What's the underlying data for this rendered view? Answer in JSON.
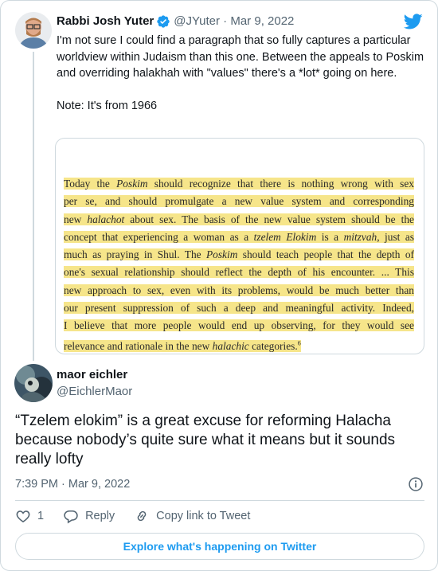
{
  "quoted_tweet": {
    "author_name": "Rabbi Josh Yuter",
    "handle_date": "@JYuter · Mar 9, 2022",
    "text": "I'm not sure I could find a paragraph that so fully captures a particular worldview within Judaism than this one. Between the appeals to Poskim and overriding halakhah with \"values\" there's a *lot* going on here.\n\nNote: It's from 1966",
    "image": {
      "lines": [
        [
          "Today the ",
          {
            "i": "Poskim"
          },
          " should recognize that there is nothing wrong with sex"
        ],
        [
          "per se, and should promulgate a new value system and corresponding"
        ],
        [
          "new ",
          {
            "i": "halachot"
          },
          " about sex. The basis of the new value system should be the"
        ],
        [
          "concept that experiencing a woman as a ",
          {
            "i": "tzelem Elokim"
          },
          " is a ",
          {
            "i": "mitzvah"
          },
          ", just as"
        ],
        [
          "much as praying in Shul. The ",
          {
            "i": "Poskim"
          },
          " should teach people that the depth of"
        ],
        [
          "one's sexual relationship should reflect the depth of his encounter. ... This"
        ],
        [
          "new approach to sex, even with its problems, would be much better than"
        ],
        [
          "our present suppression of such a deep and meaningful activity. Indeed,"
        ],
        [
          "I believe that more people would end up observing, for they would see"
        ],
        [
          "relevance and rationale in the new ",
          {
            "i": "halachic"
          },
          " categories.",
          {
            "sup": "6"
          }
        ]
      ]
    }
  },
  "tweet": {
    "author_name": "maor eichler",
    "handle": "@EichlerMaor",
    "text": "“Tzelem elokim” is a great excuse for reforming Halacha because nobody’s quite sure what it means but it sounds really lofty",
    "timestamp": "7:39 PM · Mar 9, 2022"
  },
  "actions": {
    "like_count": "1",
    "reply_label": "Reply",
    "copy_link_label": "Copy link to Tweet"
  },
  "explore_label": "Explore what's happening on Twitter",
  "colors": {
    "accent": "#1d9bf0",
    "secondary_text": "#536471",
    "border": "#cfd9de",
    "highlight": "#f6e58a"
  },
  "icons": {
    "verified": "verified-badge-icon",
    "brand": "twitter-bird-icon",
    "info": "info-icon",
    "like": "heart-icon",
    "reply": "reply-bubble-icon",
    "copy_link": "link-icon"
  }
}
